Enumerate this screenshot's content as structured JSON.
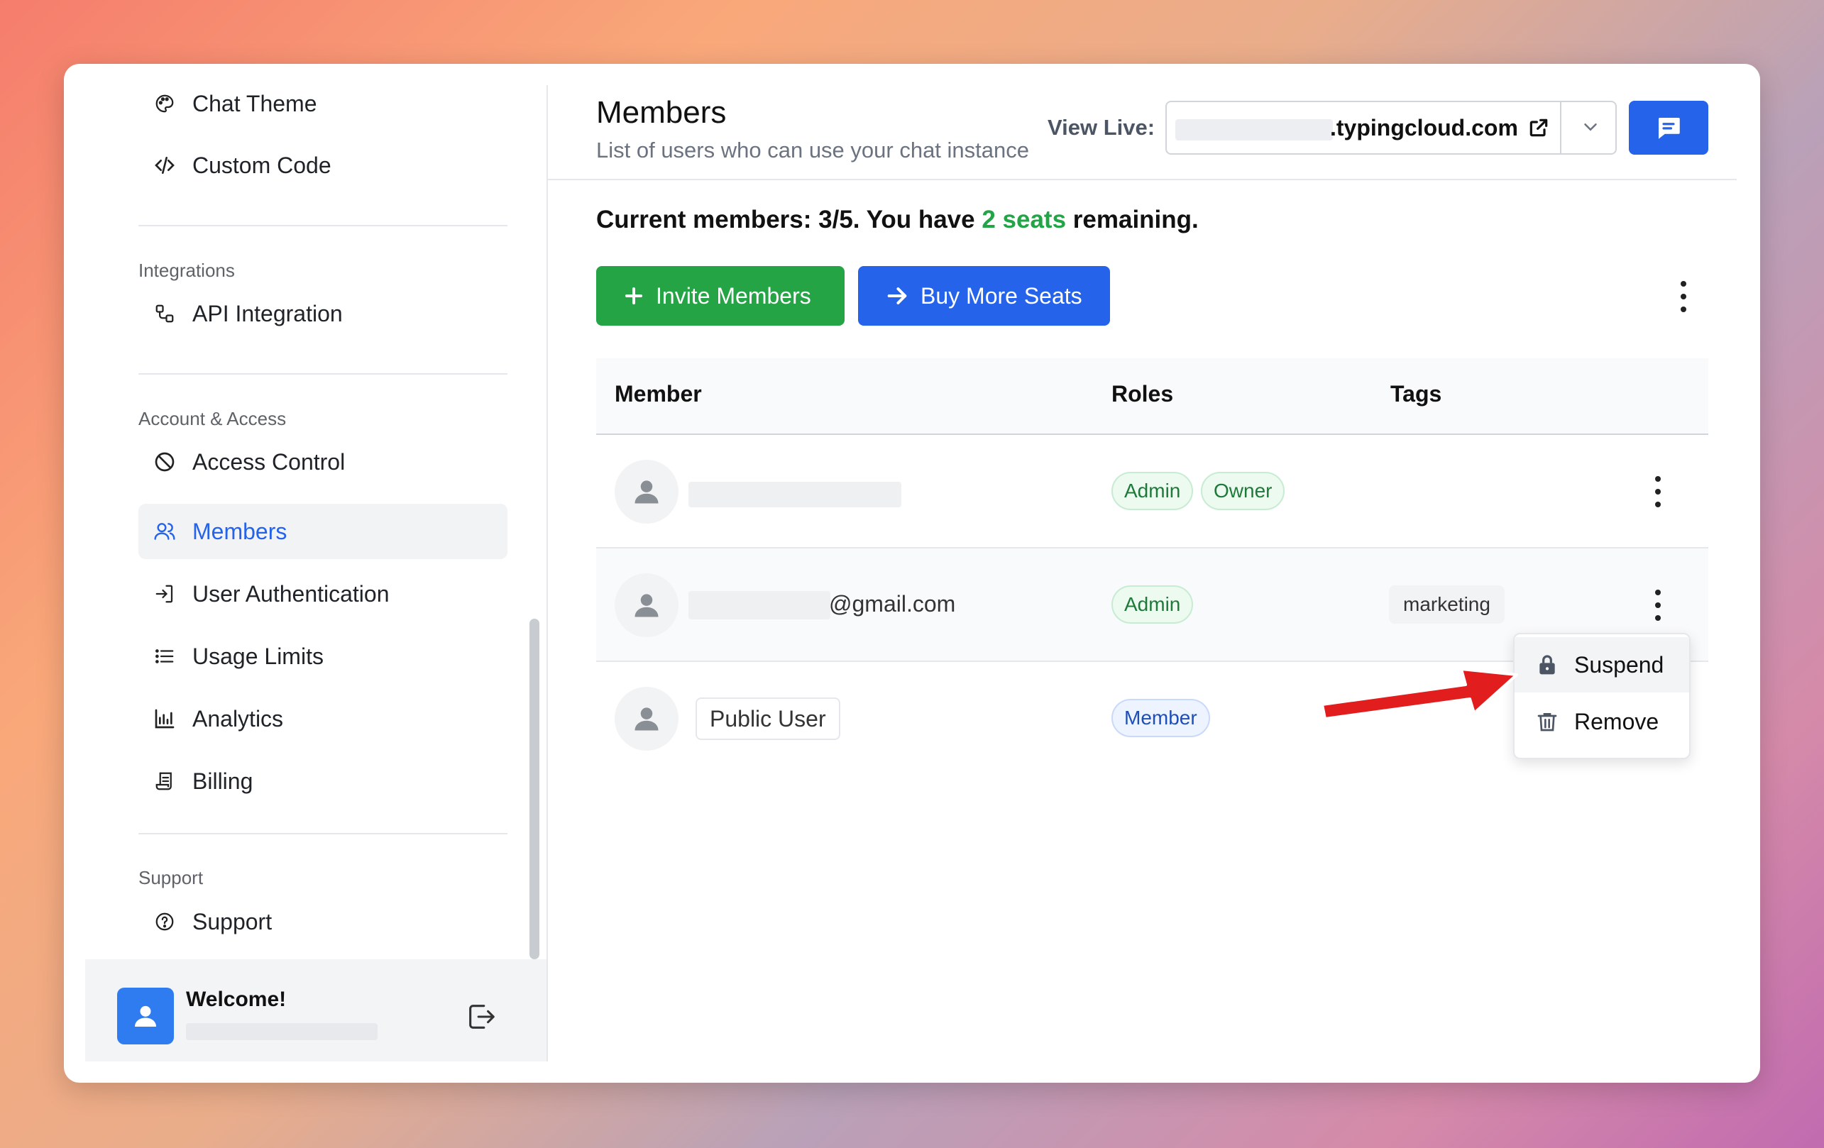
{
  "sidebar": {
    "items_top": [
      {
        "label": "Chat Theme",
        "icon": "palette-icon"
      },
      {
        "label": "Custom Code",
        "icon": "code-icon"
      }
    ],
    "section_integrations": "Integrations",
    "integrations": [
      {
        "label": "API Integration",
        "icon": "api-icon"
      }
    ],
    "section_account": "Account & Access",
    "account": [
      {
        "label": "Access Control",
        "icon": "block-icon"
      },
      {
        "label": "Members",
        "icon": "users-icon",
        "active": true
      },
      {
        "label": "User Authentication",
        "icon": "login-icon"
      },
      {
        "label": "Usage Limits",
        "icon": "list-icon"
      },
      {
        "label": "Analytics",
        "icon": "bar-chart-icon"
      },
      {
        "label": "Billing",
        "icon": "receipt-icon"
      }
    ],
    "section_support": "Support",
    "support": [
      {
        "label": "Support",
        "icon": "help-icon"
      }
    ],
    "footer": {
      "welcome": "Welcome!"
    }
  },
  "header": {
    "title": "Members",
    "subtitle": "List of users who can use your chat instance",
    "view_live_label": "View Live:",
    "url": ".typingcloud.com"
  },
  "summary": {
    "prefix": "Current members: 3/5. You have ",
    "seats": "2 seats",
    "suffix": " remaining."
  },
  "actions": {
    "invite": "Invite Members",
    "buy": "Buy More Seats"
  },
  "table": {
    "columns": [
      "Member",
      "Roles",
      "Tags"
    ],
    "rows": [
      {
        "name": "",
        "roles": [
          "Admin",
          "Owner"
        ],
        "tags": []
      },
      {
        "name": "@gmail.com",
        "roles": [
          "Admin"
        ],
        "tags": [
          "marketing"
        ]
      },
      {
        "name": "Public User",
        "roles": [
          "Member"
        ],
        "tags": []
      }
    ]
  },
  "menu": {
    "suspend": "Suspend",
    "remove": "Remove"
  },
  "colors": {
    "primary": "#2563eb",
    "success": "#25a445",
    "arrow": "#e11d1d"
  }
}
